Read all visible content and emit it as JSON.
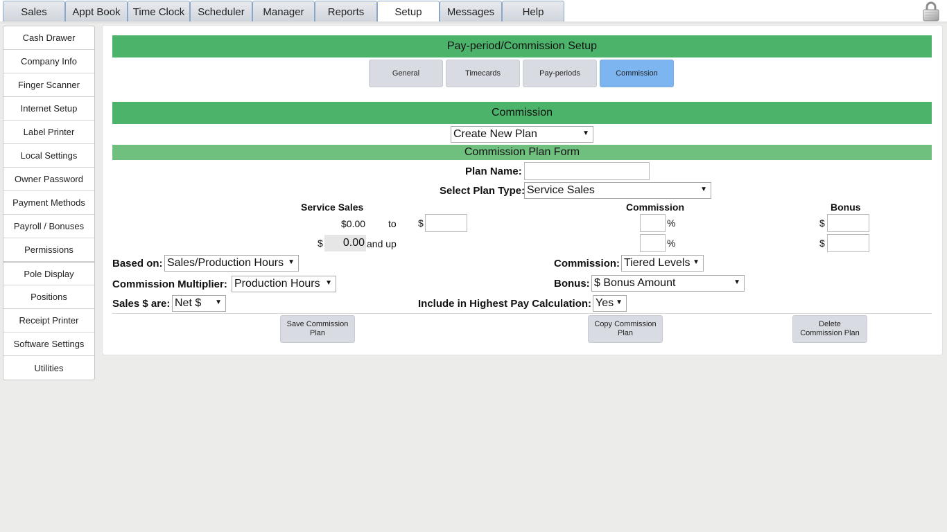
{
  "top_tabs": [
    {
      "label": "Sales"
    },
    {
      "label": "Appt Book"
    },
    {
      "label": "Time Clock"
    },
    {
      "label": "Scheduler"
    },
    {
      "label": "Manager"
    },
    {
      "label": "Reports"
    },
    {
      "label": "Setup",
      "active": true
    },
    {
      "label": "Messages"
    },
    {
      "label": "Help"
    }
  ],
  "sidebar": {
    "items": [
      {
        "label": "Cash Drawer"
      },
      {
        "label": "Company Info"
      },
      {
        "label": "Finger Scanner"
      },
      {
        "label": "Internet Setup"
      },
      {
        "label": "Label Printer"
      },
      {
        "label": "Local Settings"
      },
      {
        "label": "Owner Password"
      },
      {
        "label": "Payment Methods"
      },
      {
        "label": "Payroll / Bonuses"
      },
      {
        "label": "Permissions"
      },
      {
        "label": "Pole Display"
      },
      {
        "label": "Positions"
      },
      {
        "label": "Receipt Printer"
      },
      {
        "label": "Software Settings"
      },
      {
        "label": "Utilities"
      }
    ]
  },
  "main": {
    "header": "Pay-period/Commission Setup",
    "subtabs": [
      {
        "label": "General"
      },
      {
        "label": "Timecards"
      },
      {
        "label": "Pay-periods"
      },
      {
        "label": "Commission",
        "active": true
      }
    ],
    "commission_header": "Commission",
    "plan_select": "Create New Plan",
    "form_header": "Commission Plan Form",
    "form": {
      "plan_name_label": "Plan Name:",
      "plan_name_value": "",
      "plan_type_label": "Select Plan Type:",
      "plan_type_value": "Service Sales",
      "col_service_sales": "Service Sales",
      "col_commission": "Commission",
      "col_bonus": "Bonus",
      "row1_from": "$0.00",
      "row1_to": "to",
      "dollar": "$",
      "percent": "%",
      "row2_value": "0.00",
      "row2_suffix": "and up",
      "based_on_label": "Based on:",
      "based_on_value": "Sales/Production Hours",
      "commission_label": "Commission:",
      "commission_value": "Tiered Levels",
      "multiplier_label": "Commission Multiplier:",
      "multiplier_value": "Production Hours",
      "bonus_label": "Bonus:",
      "bonus_value": "$ Bonus Amount",
      "sales_are_label": "Sales $ are:",
      "sales_are_value": "Net $",
      "highest_pay_label": "Include in Highest Pay Calculation:",
      "highest_pay_value": "Yes"
    },
    "buttons": {
      "save": "Save Commission Plan",
      "copy": "Copy Commission Plan",
      "delete": "Delete Commission Plan"
    }
  },
  "colors": {
    "header_green": "#4cb36a",
    "subheader_green": "#6fc07e",
    "active_subtab": "#7cb5f0"
  },
  "icons": {
    "lock": "lock-icon",
    "dropdown": "triangle-down"
  }
}
